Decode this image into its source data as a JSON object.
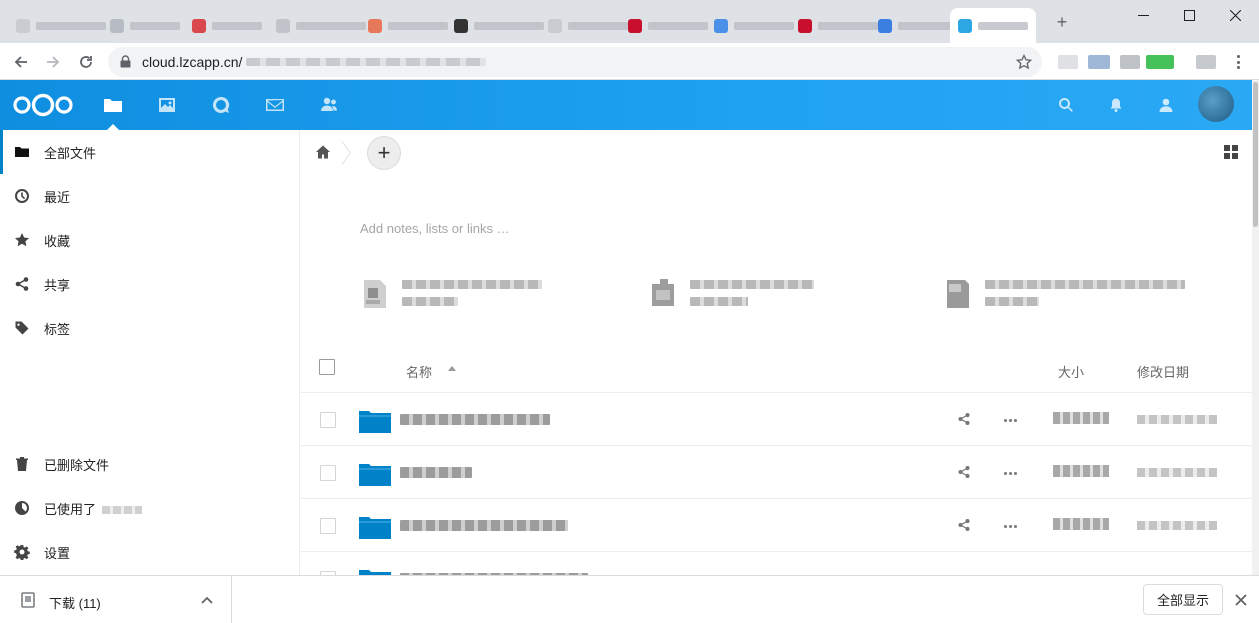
{
  "browser": {
    "url_host": "cloud.lzcapp.cn/",
    "new_tab_label": "+",
    "window_controls": [
      "minimize",
      "maximize",
      "close"
    ]
  },
  "header": {
    "apps": [
      {
        "name": "files",
        "icon": "folder-icon"
      },
      {
        "name": "photos",
        "icon": "image-icon"
      },
      {
        "name": "talk",
        "icon": "talk-icon"
      },
      {
        "name": "mail",
        "icon": "mail-icon"
      },
      {
        "name": "contacts",
        "icon": "contacts-icon"
      }
    ],
    "right_icons": [
      "search-icon",
      "bell-icon",
      "user-icon"
    ],
    "brand_color": "#0082c9"
  },
  "sidebar": {
    "items": [
      {
        "label": "全部文件",
        "icon": "folder-icon"
      },
      {
        "label": "最近",
        "icon": "clock-icon"
      },
      {
        "label": "收藏",
        "icon": "star-icon"
      },
      {
        "label": "共享",
        "icon": "share-icon"
      },
      {
        "label": "标签",
        "icon": "tag-icon"
      }
    ],
    "bottom": [
      {
        "label": "已删除文件",
        "icon": "trash-icon"
      },
      {
        "label": "已使用了",
        "icon": "pie-icon"
      },
      {
        "label": "设置",
        "icon": "gear-icon"
      }
    ]
  },
  "main": {
    "add_label": "+",
    "notes_placeholder": "Add notes, lists or links …",
    "columns": {
      "name": "名称",
      "size": "大小",
      "modified": "修改日期"
    }
  },
  "downloads": {
    "item_label": "下载 (11)",
    "show_all": "全部显示"
  }
}
